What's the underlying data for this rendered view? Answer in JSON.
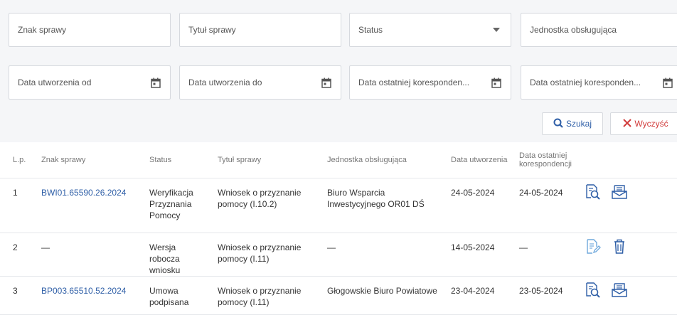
{
  "filters": {
    "row1": [
      "Znak sprawy",
      "Tytuł sprawy",
      "Status",
      "Jednostka obsługująca"
    ],
    "row2": [
      "Data utworzenia od",
      "Data utworzenia do",
      "Data ostatniej koresponden...",
      "Data ostatniej koresponden..."
    ],
    "search_label": "Szukaj",
    "clear_label": "Wyczyść"
  },
  "table": {
    "headers": {
      "lp": "L.p.",
      "case_no": "Znak sprawy",
      "status": "Status",
      "title": "Tytuł sprawy",
      "unit": "Jednostka obsługująca",
      "created": "Data utworzenia",
      "last_corr": "Data ostatniej korespondencji"
    },
    "rows": [
      {
        "lp": "1",
        "case_no": "BWI01.65590.26.2024",
        "status": "Weryfikacja Przyznania Pomocy",
        "title": "Wniosek o przyznanie pomocy (I.10.2)",
        "unit": "Biuro Wsparcia Inwestycyjnego OR01 DŚ",
        "created": "24-05-2024",
        "last_corr": "24-05-2024",
        "actions": [
          "view-details-icon",
          "message-icon"
        ]
      },
      {
        "lp": "2",
        "case_no": "—",
        "status": "Wersja robocza wniosku",
        "title": "Wniosek o przyznanie pomocy (I.11)",
        "unit": "—",
        "created": "14-05-2024",
        "last_corr": "—",
        "actions": [
          "edit-document-icon",
          "trash-icon"
        ]
      },
      {
        "lp": "3",
        "case_no": "BP003.65510.52.2024",
        "status": "Umowa podpisana",
        "title": "Wniosek o przyznanie pomocy (I.11)",
        "unit": "Głogowskie Biuro Powiatowe",
        "created": "23-04-2024",
        "last_corr": "23-05-2024",
        "actions": [
          "view-details-icon",
          "message-icon"
        ]
      }
    ]
  },
  "colors": {
    "link": "#2f5fa7",
    "clear": "#d13b3b",
    "icon": "#2f5fa7",
    "icon_light": "#6fa8dc"
  }
}
